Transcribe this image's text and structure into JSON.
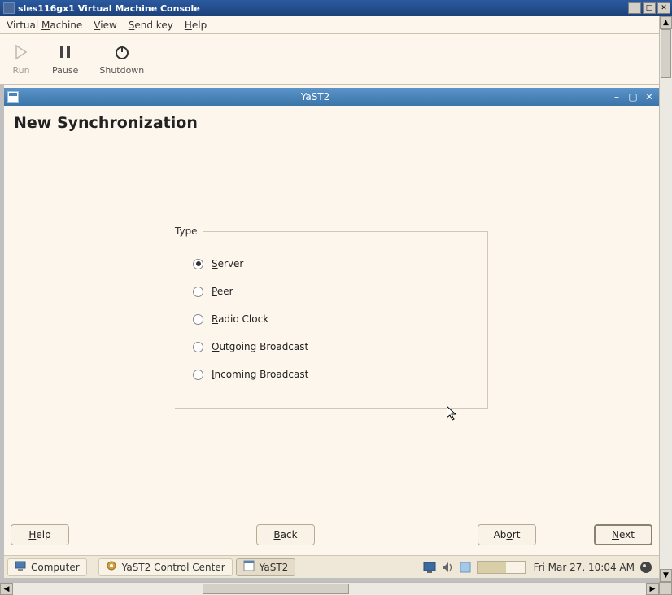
{
  "outer_window": {
    "title": "sles116gx1 Virtual Machine Console"
  },
  "vm_menu": {
    "machine": "Virtual Machine",
    "view": "View",
    "sendkey": "Send key",
    "help": "Help"
  },
  "vm_toolbar": {
    "run": "Run",
    "pause": "Pause",
    "shutdown": "Shutdown"
  },
  "inner_window": {
    "title": "YaST2"
  },
  "page": {
    "title": "New Synchronization",
    "group_label": "Type",
    "options": {
      "server": "Server",
      "peer": "Peer",
      "radio_clock": "Radio Clock",
      "outgoing": "Outgoing Broadcast",
      "incoming": "Incoming Broadcast"
    },
    "selected": "server"
  },
  "buttons": {
    "help": "Help",
    "back": "Back",
    "abort": "Abort",
    "next": "Next"
  },
  "taskbar": {
    "computer": "Computer",
    "task1": "YaST2 Control Center",
    "task2": "YaST2",
    "clock": "Fri Mar 27, 10:04 AM"
  }
}
